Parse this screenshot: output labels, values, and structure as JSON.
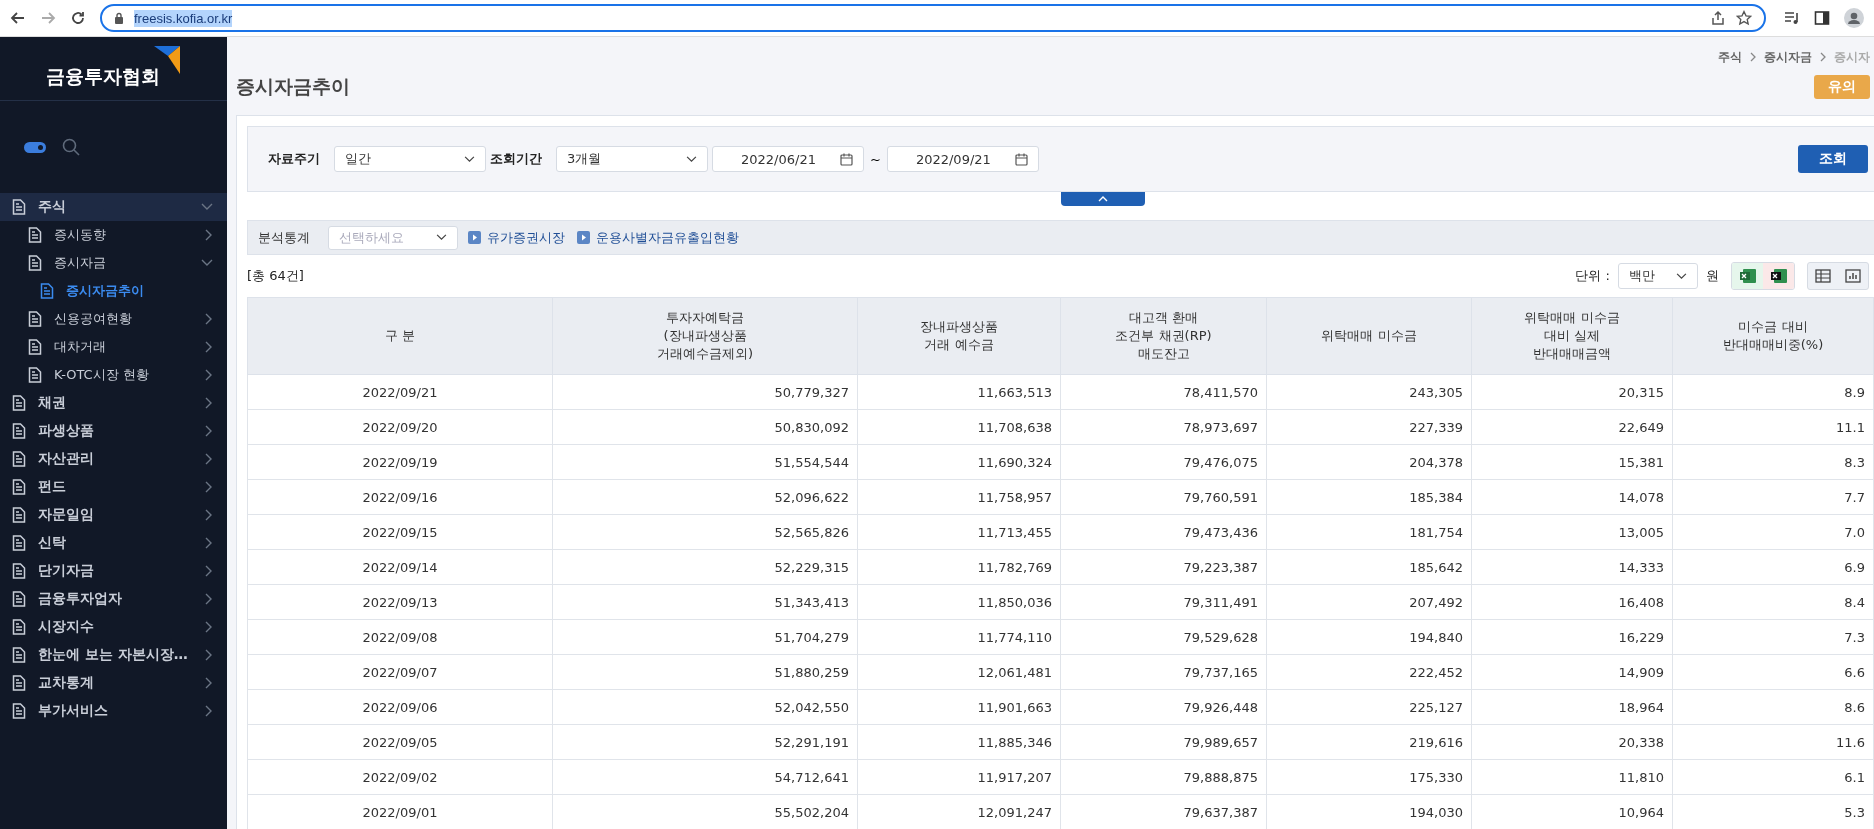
{
  "browser": {
    "url": "freesis.kofia.or.kr"
  },
  "sidebar": {
    "logo": "금융투자협회",
    "toggle": {
      "on": true
    },
    "items": [
      {
        "label": "주식",
        "expanded": true,
        "children": [
          {
            "label": "증시동향",
            "expanded": false
          },
          {
            "label": "증시자금",
            "expanded": true,
            "children": [
              {
                "label": "증시자금추이",
                "selected": true
              }
            ]
          },
          {
            "label": "신용공여현황",
            "expanded": false
          },
          {
            "label": "대차거래",
            "expanded": false
          },
          {
            "label": "K-OTC시장 현황",
            "expanded": false
          }
        ]
      },
      {
        "label": "채권",
        "expanded": false
      },
      {
        "label": "파생상품",
        "expanded": false
      },
      {
        "label": "자산관리",
        "expanded": false
      },
      {
        "label": "펀드",
        "expanded": false
      },
      {
        "label": "자문일임",
        "expanded": false
      },
      {
        "label": "신탁",
        "expanded": false
      },
      {
        "label": "단기자금",
        "expanded": false
      },
      {
        "label": "금융투자업자",
        "expanded": false
      },
      {
        "label": "시장지수",
        "expanded": false
      },
      {
        "label": "한눈에 보는 자본시장…",
        "expanded": false
      },
      {
        "label": "교차통계",
        "expanded": false
      },
      {
        "label": "부가서비스",
        "expanded": false
      }
    ]
  },
  "breadcrumb": [
    "주식",
    "증시자금",
    "증시자"
  ],
  "page_title": "증시자금추이",
  "notice_badge": "유의",
  "filters": {
    "period_label": "자료주기",
    "period_value": "일간",
    "range_label": "조회기간",
    "range_value": "3개월",
    "start_date": "2022/06/21",
    "separator": "~",
    "end_date": "2022/09/21",
    "search_button": "조회"
  },
  "analysis": {
    "label": "분석통계",
    "select_placeholder": "선택하세요",
    "links": [
      "유가증권시장",
      "운용사별자금유출입현황"
    ]
  },
  "total_count": "[총 64건]",
  "unit": {
    "label": "단위 :",
    "value": "백만",
    "suffix": "원"
  },
  "table": {
    "columns": [
      "구 분",
      "투자자예탁금\n(장내파생상품\n거래예수금제외)",
      "장내파생상품\n거래 예수금",
      "대고객 환매\n조건부 채권(RP)\n매도잔고",
      "위탁매매 미수금",
      "위탁매매 미수금\n대비 실제\n반대매매금액",
      "미수금 대비\n반대매매비중(%)"
    ],
    "rows": [
      [
        "2022/09/21",
        "50,779,327",
        "11,663,513",
        "78,411,570",
        "243,305",
        "20,315",
        "8.9"
      ],
      [
        "2022/09/20",
        "50,830,092",
        "11,708,638",
        "78,973,697",
        "227,339",
        "22,649",
        "11.1"
      ],
      [
        "2022/09/19",
        "51,554,544",
        "11,690,324",
        "79,476,075",
        "204,378",
        "15,381",
        "8.3"
      ],
      [
        "2022/09/16",
        "52,096,622",
        "11,758,957",
        "79,760,591",
        "185,384",
        "14,078",
        "7.7"
      ],
      [
        "2022/09/15",
        "52,565,826",
        "11,713,455",
        "79,473,436",
        "181,754",
        "13,005",
        "7.0"
      ],
      [
        "2022/09/14",
        "52,229,315",
        "11,782,769",
        "79,223,387",
        "185,642",
        "14,333",
        "6.9"
      ],
      [
        "2022/09/13",
        "51,343,413",
        "11,850,036",
        "79,311,491",
        "207,492",
        "16,408",
        "8.4"
      ],
      [
        "2022/09/08",
        "51,704,279",
        "11,774,110",
        "79,529,628",
        "194,840",
        "16,229",
        "7.3"
      ],
      [
        "2022/09/07",
        "51,880,259",
        "12,061,481",
        "79,737,165",
        "222,452",
        "14,909",
        "6.6"
      ],
      [
        "2022/09/06",
        "52,042,550",
        "11,901,663",
        "79,926,448",
        "225,127",
        "18,964",
        "8.6"
      ],
      [
        "2022/09/05",
        "52,291,191",
        "11,885,346",
        "79,989,657",
        "219,616",
        "20,338",
        "11.6"
      ],
      [
        "2022/09/02",
        "54,712,641",
        "11,917,207",
        "79,888,875",
        "175,330",
        "11,810",
        "6.1"
      ],
      [
        "2022/09/01",
        "55,502,204",
        "12,091,247",
        "79,637,387",
        "194,030",
        "10,964",
        "5.3"
      ]
    ]
  }
}
